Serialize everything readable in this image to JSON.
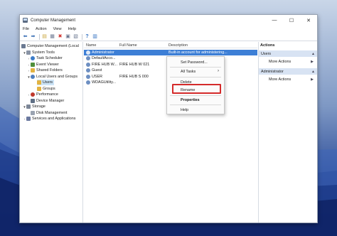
{
  "window": {
    "title": "Computer Management",
    "controls": {
      "minimize": "—",
      "maximize": "☐",
      "close": "✕"
    }
  },
  "menubar": [
    "File",
    "Action",
    "View",
    "Help"
  ],
  "toolbar": {
    "icons": [
      "back-arrow-icon",
      "forward-arrow-icon",
      "up-folder-icon",
      "properties-icon",
      "delete-icon",
      "export-icon",
      "refresh-icon",
      "help-icon",
      "show-hide-icon"
    ],
    "glyphs": [
      "⬅",
      "➡",
      "▤",
      "▦",
      "✖",
      "▣",
      "▧",
      "?",
      "▥"
    ]
  },
  "tree": [
    {
      "label": "Computer Management (Local",
      "icon": "computer-icon"
    },
    {
      "label": "System Tools",
      "icon": "tools-icon"
    },
    {
      "label": "Task Scheduler",
      "icon": "clock-icon"
    },
    {
      "label": "Event Viewer",
      "icon": "event-viewer-icon"
    },
    {
      "label": "Shared Folders",
      "icon": "folder-icon"
    },
    {
      "label": "Local Users and Groups",
      "icon": "users-group-icon"
    },
    {
      "label": "Users",
      "icon": "folder-icon"
    },
    {
      "label": "Groups",
      "icon": "folder-icon"
    },
    {
      "label": "Performance",
      "icon": "performance-icon"
    },
    {
      "label": "Device Manager",
      "icon": "device-manager-icon"
    },
    {
      "label": "Storage",
      "icon": "storage-icon"
    },
    {
      "label": "Disk Management",
      "icon": "disk-icon"
    },
    {
      "label": "Services and Applications",
      "icon": "services-icon"
    }
  ],
  "table": {
    "columns": [
      "Name",
      "Full Name",
      "Description"
    ],
    "rows": [
      {
        "name": "Administrator",
        "full_name": "",
        "description": "Built-in account for administering..."
      },
      {
        "name": "DefaultAcco...",
        "full_name": "",
        "description": ""
      },
      {
        "name": "FIRE HUB W...",
        "full_name": "FIRE HUB W 021",
        "description": ""
      },
      {
        "name": "Guest",
        "full_name": "",
        "description": ""
      },
      {
        "name": "USER",
        "full_name": "FIRE HUB S 000",
        "description": ""
      },
      {
        "name": "WDAGUtility...",
        "full_name": "",
        "description": ""
      }
    ]
  },
  "context_menu": {
    "items": [
      "Set Password...",
      "All Tasks",
      "Delete",
      "Rename",
      "Properties",
      "Help"
    ],
    "submenu_arrow": "›"
  },
  "actions": {
    "header": "Actions",
    "sections": [
      {
        "title": "Users",
        "more": "More Actions"
      },
      {
        "title": "Administrator",
        "more": "More Actions"
      }
    ],
    "caret_up": "▲",
    "caret_right": "▶"
  },
  "colors": {
    "selection": "#3d7fd6",
    "highlight_box": "#d42a2a",
    "section_bg": "#d8e3f3"
  }
}
